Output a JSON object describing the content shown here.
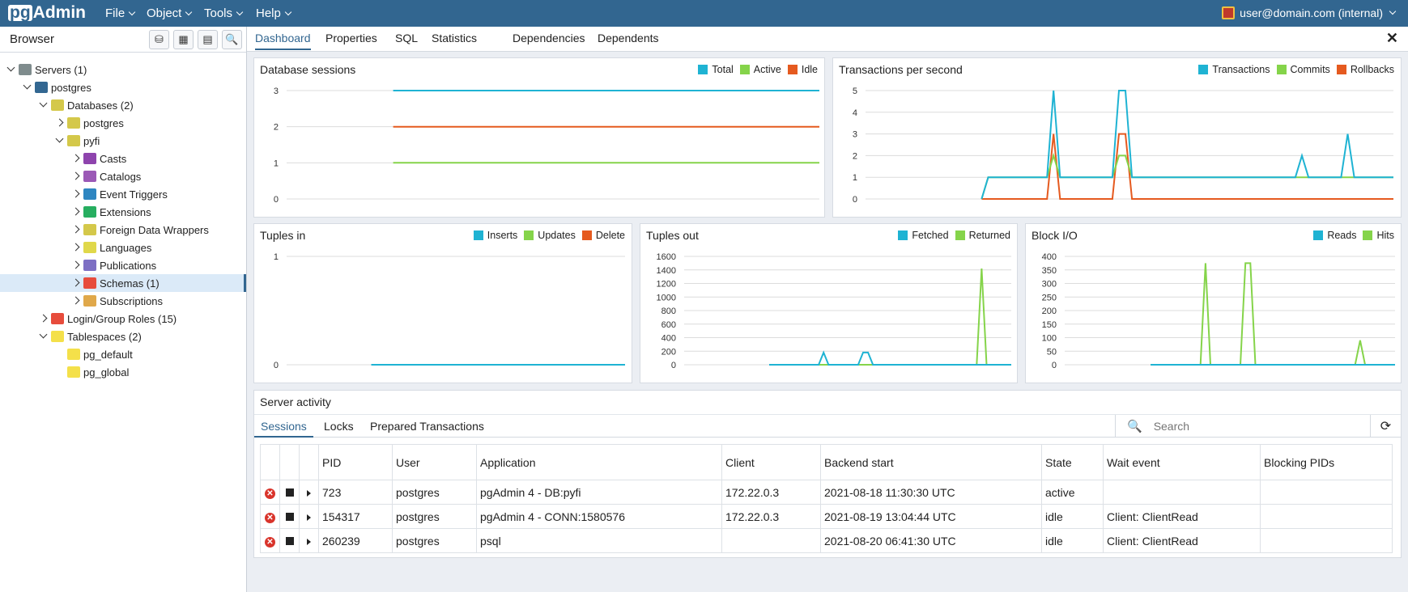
{
  "app": {
    "logo_pg": "pg",
    "logo_admin": "Admin"
  },
  "menu": {
    "file": "File",
    "object": "Object",
    "tools": "Tools",
    "help": "Help",
    "user": "user@domain.com (internal)"
  },
  "browser": {
    "title": "Browser",
    "tree": [
      {
        "label": "Servers (1)",
        "indent": 0,
        "toggle": "open",
        "icon": "servers-icon",
        "color": "#7f8c8d"
      },
      {
        "label": "postgres",
        "indent": 1,
        "toggle": "open",
        "icon": "elephant-icon",
        "color": "#336791"
      },
      {
        "label": "Databases (2)",
        "indent": 2,
        "toggle": "open",
        "icon": "databases-icon",
        "color": "#d4c84a"
      },
      {
        "label": "postgres",
        "indent": 3,
        "toggle": "closed",
        "icon": "database-icon",
        "color": "#d4c84a"
      },
      {
        "label": "pyfi",
        "indent": 3,
        "toggle": "open",
        "icon": "database-icon",
        "color": "#d4c84a"
      },
      {
        "label": "Casts",
        "indent": 4,
        "toggle": "closed",
        "icon": "casts-icon",
        "color": "#8e44ad"
      },
      {
        "label": "Catalogs",
        "indent": 4,
        "toggle": "closed",
        "icon": "catalogs-icon",
        "color": "#9b59b6"
      },
      {
        "label": "Event Triggers",
        "indent": 4,
        "toggle": "closed",
        "icon": "event-triggers-icon",
        "color": "#2e86c1"
      },
      {
        "label": "Extensions",
        "indent": 4,
        "toggle": "closed",
        "icon": "extensions-icon",
        "color": "#27ae60"
      },
      {
        "label": "Foreign Data Wrappers",
        "indent": 4,
        "toggle": "closed",
        "icon": "fdw-icon",
        "color": "#d4c84a"
      },
      {
        "label": "Languages",
        "indent": 4,
        "toggle": "closed",
        "icon": "languages-icon",
        "color": "#e0d84a"
      },
      {
        "label": "Publications",
        "indent": 4,
        "toggle": "closed",
        "icon": "publications-icon",
        "color": "#7d6fc4"
      },
      {
        "label": "Schemas (1)",
        "indent": 4,
        "toggle": "closed",
        "icon": "schemas-icon",
        "color": "#e74c3c",
        "selected": true
      },
      {
        "label": "Subscriptions",
        "indent": 4,
        "toggle": "closed",
        "icon": "subscriptions-icon",
        "color": "#e0a84a"
      },
      {
        "label": "Login/Group Roles (15)",
        "indent": 2,
        "toggle": "closed",
        "icon": "roles-icon",
        "color": "#e74c3c"
      },
      {
        "label": "Tablespaces (2)",
        "indent": 2,
        "toggle": "open",
        "icon": "tablespaces-icon",
        "color": "#f4e04a"
      },
      {
        "label": "pg_default",
        "indent": 3,
        "toggle": "none",
        "icon": "folder-icon",
        "color": "#f4e04a"
      },
      {
        "label": "pg_global",
        "indent": 3,
        "toggle": "none",
        "icon": "folder-icon",
        "color": "#f4e04a"
      }
    ]
  },
  "tabs": [
    "Dashboard",
    "Properties",
    "SQL",
    "Statistics",
    "Dependencies",
    "Dependents"
  ],
  "colors": {
    "blue": "#1fb3d3",
    "green": "#85d44a",
    "orange": "#e55a1f"
  },
  "panels": {
    "sessions": {
      "title": "Database sessions",
      "legend": [
        "Total",
        "Active",
        "Idle"
      ]
    },
    "tps": {
      "title": "Transactions per second",
      "legend": [
        "Transactions",
        "Commits",
        "Rollbacks"
      ]
    },
    "tuples_in": {
      "title": "Tuples in",
      "legend": [
        "Inserts",
        "Updates",
        "Delete"
      ]
    },
    "tuples_out": {
      "title": "Tuples out",
      "legend": [
        "Fetched",
        "Returned"
      ]
    },
    "block_io": {
      "title": "Block I/O",
      "legend": [
        "Reads",
        "Hits"
      ]
    }
  },
  "chart_data": [
    {
      "id": "sessions",
      "type": "line",
      "ylim": [
        0,
        3
      ],
      "yticks": [
        0,
        1,
        2,
        3
      ],
      "x_start": 0.2,
      "n": 40,
      "series": [
        {
          "name": "Total",
          "color": "#1fb3d3",
          "values": [
            3,
            3,
            3,
            3,
            3,
            3,
            3,
            3,
            3,
            3,
            3,
            3,
            3,
            3,
            3,
            3,
            3,
            3,
            3,
            3,
            3,
            3,
            3,
            3,
            3,
            3,
            3,
            3,
            3,
            3,
            3,
            3,
            3,
            3,
            3,
            3,
            3,
            3,
            3,
            3
          ]
        },
        {
          "name": "Active",
          "color": "#85d44a",
          "values": [
            1,
            1,
            1,
            1,
            1,
            1,
            1,
            1,
            1,
            1,
            1,
            1,
            1,
            1,
            1,
            1,
            1,
            1,
            1,
            1,
            1,
            1,
            1,
            1,
            1,
            1,
            1,
            1,
            1,
            1,
            1,
            1,
            1,
            1,
            1,
            1,
            1,
            1,
            1,
            1
          ]
        },
        {
          "name": "Idle",
          "color": "#e55a1f",
          "values": [
            2,
            2,
            2,
            2,
            2,
            2,
            2,
            2,
            2,
            2,
            2,
            2,
            2,
            2,
            2,
            2,
            2,
            2,
            2,
            2,
            2,
            2,
            2,
            2,
            2,
            2,
            2,
            2,
            2,
            2,
            2,
            2,
            2,
            2,
            2,
            2,
            2,
            2,
            2,
            2
          ]
        }
      ]
    },
    {
      "id": "tps",
      "type": "line",
      "ylim": [
        0,
        5
      ],
      "yticks": [
        0,
        1,
        2,
        3,
        4,
        5
      ],
      "x_start": 0.22,
      "n": 64,
      "series": [
        {
          "name": "Rollbacks",
          "color": "#e55a1f",
          "values": [
            0,
            0,
            0,
            0,
            0,
            0,
            0,
            0,
            0,
            0,
            0,
            3,
            0,
            0,
            0,
            0,
            0,
            0,
            0,
            0,
            0,
            3,
            3,
            0,
            0,
            0,
            0,
            0,
            0,
            0,
            0,
            0,
            0,
            0,
            0,
            0,
            0,
            0,
            0,
            0,
            0,
            0,
            0,
            0,
            0,
            0,
            0,
            0,
            0,
            0,
            0,
            0,
            0,
            0,
            0,
            0,
            0,
            0,
            0,
            0,
            0,
            0,
            0,
            0
          ]
        },
        {
          "name": "Commits",
          "color": "#85d44a",
          "values": [
            0,
            1,
            1,
            1,
            1,
            1,
            1,
            1,
            1,
            1,
            1,
            2,
            1,
            1,
            1,
            1,
            1,
            1,
            1,
            1,
            1,
            2,
            2,
            1,
            1,
            1,
            1,
            1,
            1,
            1,
            1,
            1,
            1,
            1,
            1,
            1,
            1,
            1,
            1,
            1,
            1,
            1,
            1,
            1,
            1,
            1,
            1,
            1,
            1,
            1,
            1,
            1,
            1,
            1,
            1,
            1,
            1,
            1,
            1,
            1,
            1,
            1,
            1,
            1
          ]
        },
        {
          "name": "Transactions",
          "color": "#1fb3d3",
          "values": [
            0,
            1,
            1,
            1,
            1,
            1,
            1,
            1,
            1,
            1,
            1,
            5,
            1,
            1,
            1,
            1,
            1,
            1,
            1,
            1,
            1,
            5,
            5,
            1,
            1,
            1,
            1,
            1,
            1,
            1,
            1,
            1,
            1,
            1,
            1,
            1,
            1,
            1,
            1,
            1,
            1,
            1,
            1,
            1,
            1,
            1,
            1,
            1,
            1,
            2,
            1,
            1,
            1,
            1,
            1,
            1,
            3,
            1,
            1,
            1,
            1,
            1,
            1,
            1
          ]
        }
      ]
    },
    {
      "id": "tuples_in",
      "type": "line",
      "ylim": [
        0,
        1
      ],
      "yticks": [
        0,
        1
      ],
      "x_start": 0.25,
      "n": 40,
      "series": [
        {
          "name": "Inserts",
          "color": "#1fb3d3",
          "values": [
            0,
            0,
            0,
            0,
            0,
            0,
            0,
            0,
            0,
            0,
            0,
            0,
            0,
            0,
            0,
            0,
            0,
            0,
            0,
            0,
            0,
            0,
            0,
            0,
            0,
            0,
            0,
            0,
            0,
            0,
            0,
            0,
            0,
            0,
            0,
            0,
            0,
            0,
            0,
            0
          ]
        }
      ]
    },
    {
      "id": "tuples_out",
      "type": "line",
      "ylim": [
        0,
        1600
      ],
      "yticks": [
        0,
        200,
        400,
        600,
        800,
        1000,
        1200,
        1400,
        1600
      ],
      "x_start": 0.26,
      "n": 50,
      "series": [
        {
          "name": "Returned",
          "color": "#85d44a",
          "values": [
            0,
            0,
            0,
            0,
            0,
            0,
            0,
            0,
            0,
            0,
            0,
            0,
            0,
            0,
            0,
            0,
            0,
            0,
            0,
            0,
            0,
            0,
            0,
            0,
            0,
            0,
            0,
            0,
            0,
            0,
            0,
            0,
            0,
            0,
            0,
            0,
            0,
            0,
            0,
            0,
            0,
            0,
            0,
            1420,
            0,
            0,
            0,
            0,
            0,
            0
          ]
        },
        {
          "name": "Fetched",
          "color": "#1fb3d3",
          "values": [
            0,
            0,
            0,
            0,
            0,
            0,
            0,
            0,
            0,
            0,
            0,
            180,
            0,
            0,
            0,
            0,
            0,
            0,
            0,
            180,
            180,
            0,
            0,
            0,
            0,
            0,
            0,
            0,
            0,
            0,
            0,
            0,
            0,
            0,
            0,
            0,
            0,
            0,
            0,
            0,
            0,
            0,
            0,
            0,
            0,
            0,
            0,
            0,
            0,
            0
          ]
        }
      ]
    },
    {
      "id": "block_io",
      "type": "line",
      "ylim": [
        0,
        400
      ],
      "yticks": [
        0,
        50,
        100,
        150,
        200,
        250,
        300,
        350,
        400
      ],
      "x_start": 0.26,
      "n": 50,
      "series": [
        {
          "name": "Hits",
          "color": "#85d44a",
          "values": [
            0,
            0,
            0,
            0,
            0,
            0,
            0,
            0,
            0,
            0,
            0,
            375,
            0,
            0,
            0,
            0,
            0,
            0,
            0,
            375,
            375,
            0,
            0,
            0,
            0,
            0,
            0,
            0,
            0,
            0,
            0,
            0,
            0,
            0,
            0,
            0,
            0,
            0,
            0,
            0,
            0,
            0,
            90,
            0,
            0,
            0,
            0,
            0,
            0,
            0
          ]
        },
        {
          "name": "Reads",
          "color": "#1fb3d3",
          "values": [
            0,
            0,
            0,
            0,
            0,
            0,
            0,
            0,
            0,
            0,
            0,
            0,
            0,
            0,
            0,
            0,
            0,
            0,
            0,
            0,
            0,
            0,
            0,
            0,
            0,
            0,
            0,
            0,
            0,
            0,
            0,
            0,
            0,
            0,
            0,
            0,
            0,
            0,
            0,
            0,
            0,
            0,
            0,
            0,
            0,
            0,
            0,
            0,
            0,
            0
          ]
        }
      ]
    }
  ],
  "activity": {
    "title": "Server activity",
    "subtabs": [
      "Sessions",
      "Locks",
      "Prepared Transactions"
    ],
    "search_placeholder": "Search",
    "columns": [
      "PID",
      "User",
      "Application",
      "Client",
      "Backend start",
      "State",
      "Wait event",
      "Blocking PIDs"
    ],
    "rows": [
      [
        "723",
        "postgres",
        "pgAdmin 4 - DB:pyfi",
        "172.22.0.3",
        "2021-08-18 11:30:30 UTC",
        "active",
        "",
        ""
      ],
      [
        "154317",
        "postgres",
        "pgAdmin 4 - CONN:1580576",
        "172.22.0.3",
        "2021-08-19 13:04:44 UTC",
        "idle",
        "Client: ClientRead",
        ""
      ],
      [
        "260239",
        "postgres",
        "psql",
        "",
        "2021-08-20 06:41:30 UTC",
        "idle",
        "Client: ClientRead",
        ""
      ]
    ]
  }
}
